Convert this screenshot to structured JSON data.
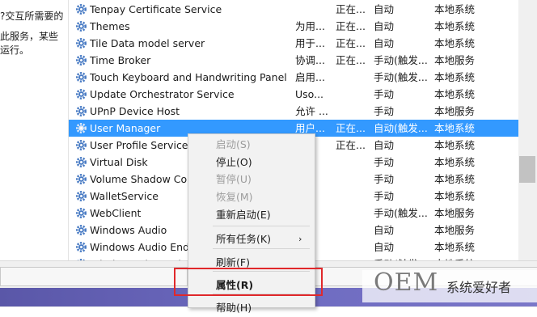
{
  "left_description": [
    "?交互所需要的",
    "此服务，某些",
    "运行。"
  ],
  "services": [
    {
      "name": "Tenpay Certificate Service",
      "desc": "",
      "status": "正在...",
      "startup": "自动",
      "logon": "本地系统",
      "selected": false
    },
    {
      "name": "Themes",
      "desc": "为用...",
      "status": "正在...",
      "startup": "自动",
      "logon": "本地系统",
      "selected": false
    },
    {
      "name": "Tile Data model server",
      "desc": "用于...",
      "status": "正在...",
      "startup": "自动",
      "logon": "本地系统",
      "selected": false
    },
    {
      "name": "Time Broker",
      "desc": "协调...",
      "status": "正在...",
      "startup": "手动(触发...",
      "logon": "本地服务",
      "selected": false
    },
    {
      "name": "Touch Keyboard and Handwriting Panel ...",
      "desc": "启用...",
      "status": "",
      "startup": "手动(触发...",
      "logon": "本地系统",
      "selected": false
    },
    {
      "name": "Update Orchestrator Service",
      "desc": "Uso...",
      "status": "",
      "startup": "手动",
      "logon": "本地系统",
      "selected": false
    },
    {
      "name": "UPnP Device Host",
      "desc": "允许 ...",
      "status": "",
      "startup": "手动",
      "logon": "本地服务",
      "selected": false
    },
    {
      "name": "User Manager",
      "desc": "用户...",
      "status": "正在...",
      "startup": "自动(触发...",
      "logon": "本地系统",
      "selected": true
    },
    {
      "name": "User Profile Service",
      "desc": "",
      "status": "正在...",
      "startup": "自动",
      "logon": "本地系统",
      "selected": false
    },
    {
      "name": "Virtual Disk",
      "desc": "",
      "status": "",
      "startup": "手动",
      "logon": "本地系统",
      "selected": false
    },
    {
      "name": "Volume Shadow Cop",
      "desc": "",
      "status": "",
      "startup": "手动",
      "logon": "本地系统",
      "selected": false
    },
    {
      "name": "WalletService",
      "desc": "",
      "status": "",
      "startup": "手动",
      "logon": "本地系统",
      "selected": false
    },
    {
      "name": "WebClient",
      "desc": "",
      "status": "",
      "startup": "手动(触发...",
      "logon": "本地服务",
      "selected": false
    },
    {
      "name": "Windows Audio",
      "desc": "",
      "status": "",
      "startup": "自动",
      "logon": "本地服务",
      "selected": false
    },
    {
      "name": "Windows Audio Endp",
      "desc": "",
      "status": "",
      "startup": "自动",
      "logon": "本地系统",
      "selected": false
    },
    {
      "name": "Windows Biometric S",
      "desc": "",
      "status": "",
      "startup": "手动(触发...",
      "logon": "本地系统",
      "selected": false
    }
  ],
  "context_menu": [
    {
      "label": "启动(S)",
      "disabled": true,
      "bold": false,
      "submenu": false
    },
    {
      "label": "停止(O)",
      "disabled": false,
      "bold": false,
      "submenu": false
    },
    {
      "label": "暂停(U)",
      "disabled": true,
      "bold": false,
      "submenu": false
    },
    {
      "label": "恢复(M)",
      "disabled": true,
      "bold": false,
      "submenu": false
    },
    {
      "label": "重新启动(E)",
      "disabled": false,
      "bold": false,
      "submenu": false
    },
    {
      "label": "所有任务(K)",
      "disabled": false,
      "bold": false,
      "submenu": true
    },
    {
      "label": "刷新(F)",
      "disabled": false,
      "bold": false,
      "submenu": false
    },
    {
      "label": "属性(R)",
      "disabled": false,
      "bold": true,
      "submenu": false
    },
    {
      "label": "帮助(H)",
      "disabled": false,
      "bold": false,
      "submenu": false
    }
  ],
  "submenu_arrow": "›",
  "watermark": {
    "brand": "OEM",
    "text": "系统爱好者"
  },
  "colors": {
    "selection": "#3399ff",
    "highlight_box": "#e0282b",
    "gear_icon": "#4a7cc4"
  }
}
